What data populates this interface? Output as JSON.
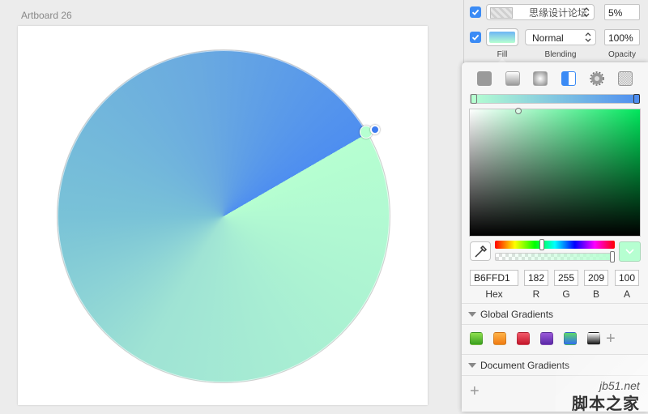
{
  "canvas": {
    "artboard_title": "Artboard 26",
    "gradient": {
      "start_color": "#b6ffd1",
      "end_color": "#4e8ef0",
      "type": "angular"
    }
  },
  "inspector": {
    "fills": [
      {
        "enabled": true,
        "label": "思缘设计论坛",
        "opacity": "5%"
      },
      {
        "enabled": true,
        "blending": "Normal",
        "opacity": "100%"
      }
    ],
    "labels": {
      "fill": "Fill",
      "blending": "Blending",
      "opacity": "Opacity"
    }
  },
  "color_picker": {
    "fill_types": [
      "flat-color",
      "linear-gradient",
      "radial-gradient",
      "angular-gradient",
      "pattern-fill",
      "noise-fill"
    ],
    "selected_fill_type": "angular-gradient",
    "gradient_stops": [
      "#b6ffd1",
      "#4e8ef0"
    ],
    "hue_level": 0.39,
    "alpha_level": 1.0,
    "values": {
      "hex": "B6FFD1",
      "r": "182",
      "g": "255",
      "b": "209",
      "a": "100"
    },
    "value_labels": {
      "hex": "Hex",
      "r": "R",
      "g": "G",
      "b": "B",
      "a": "A"
    },
    "global_gradients_title": "Global Gradients",
    "global_gradients": [
      {
        "name": "green",
        "colors": [
          "#8ee04e",
          "#3aa01f"
        ]
      },
      {
        "name": "orange",
        "colors": [
          "#ffb347",
          "#f07b12"
        ]
      },
      {
        "name": "red",
        "colors": [
          "#f25a6a",
          "#c4162b"
        ]
      },
      {
        "name": "purple",
        "colors": [
          "#9b59d8",
          "#5b2aa8"
        ]
      },
      {
        "name": "green-blue",
        "colors": [
          "#5ed96a",
          "#2f6df0"
        ]
      },
      {
        "name": "black",
        "colors": [
          "#ffffff",
          "#111111"
        ]
      }
    ],
    "document_gradients_title": "Document Gradients",
    "add_symbol": "+"
  },
  "watermark": {
    "site": "jb51.net",
    "name": "脚本之家"
  }
}
